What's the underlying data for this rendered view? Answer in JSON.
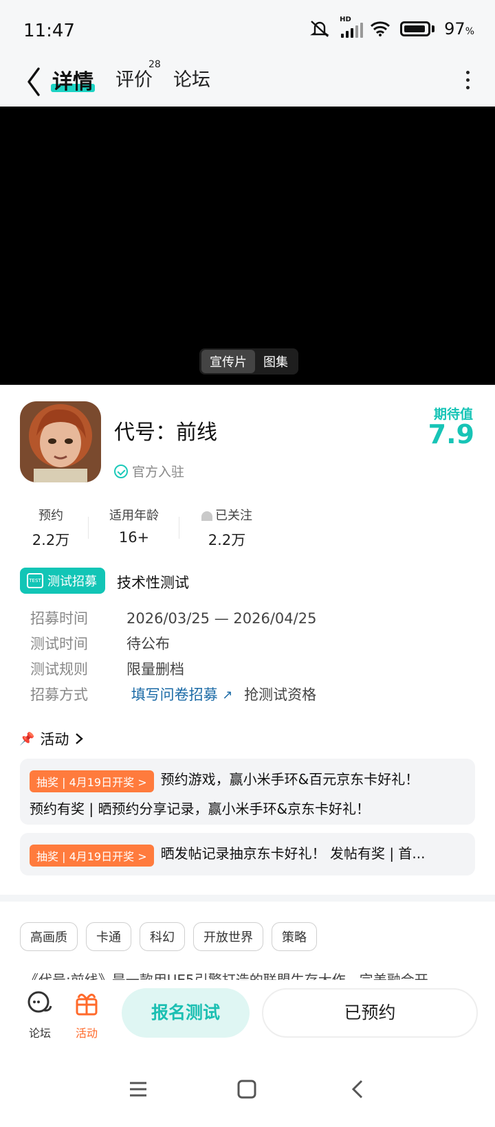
{
  "status_bar": {
    "time": "11:47",
    "net_badge": "HD",
    "battery": "97",
    "battery_unit": "%"
  },
  "header": {
    "tabs": [
      {
        "label": "详情",
        "active": true
      },
      {
        "label": "评价",
        "badge": "28"
      },
      {
        "label": "论坛"
      }
    ]
  },
  "video": {
    "switch": [
      "宣传片",
      "图集"
    ],
    "active": "宣传片"
  },
  "game": {
    "title": "代号：前线",
    "official_label": "官方入驻",
    "expect_label": "期待值",
    "expect_value": "7.9",
    "stats": [
      {
        "label": "预约",
        "value": "2.2万"
      },
      {
        "label": "适用年龄",
        "value": "16+"
      },
      {
        "label": "已关注",
        "value": "2.2万"
      }
    ]
  },
  "recruit": {
    "badge": "测试招募",
    "badge_icon_text": "TEST",
    "type": "技术性测试",
    "rows": [
      {
        "key": "招募时间",
        "value": "2026/03/25 — 2026/04/25"
      },
      {
        "key": "测试时间",
        "value": "待公布"
      },
      {
        "key": "测试规则",
        "value": "限量删档"
      },
      {
        "key": "招募方式",
        "link": "填写问卷招募",
        "suffix": "抢测试资格"
      }
    ]
  },
  "activity": {
    "title": "活动",
    "cards": [
      {
        "tag": "抽奖 | 4月19日开奖 >",
        "line1": "预约游戏，赢小米手环&百元京东卡好礼！",
        "line2": "预约有奖 | 晒预约分享记录，赢小米手环&京东卡好礼！"
      },
      {
        "tag": "抽奖 | 4月19日开奖 >",
        "line1": "晒发帖记录抽京东卡好礼！ 发帖有奖 | 首..."
      }
    ]
  },
  "tags": [
    "高画质",
    "卡通",
    "科幻",
    "开放世界",
    "策略"
  ],
  "description": "《代号:前线》是一款用UE5引擎打造的联盟生存大作，完美融合开",
  "bottom_bar": {
    "forum_label": "论坛",
    "activity_label": "活动",
    "signup_label": "报名测试",
    "reserved_label": "已预约"
  },
  "colors": {
    "accent": "#17c4b6",
    "orange": "#ff7b3d",
    "link": "#1a6aa6"
  }
}
